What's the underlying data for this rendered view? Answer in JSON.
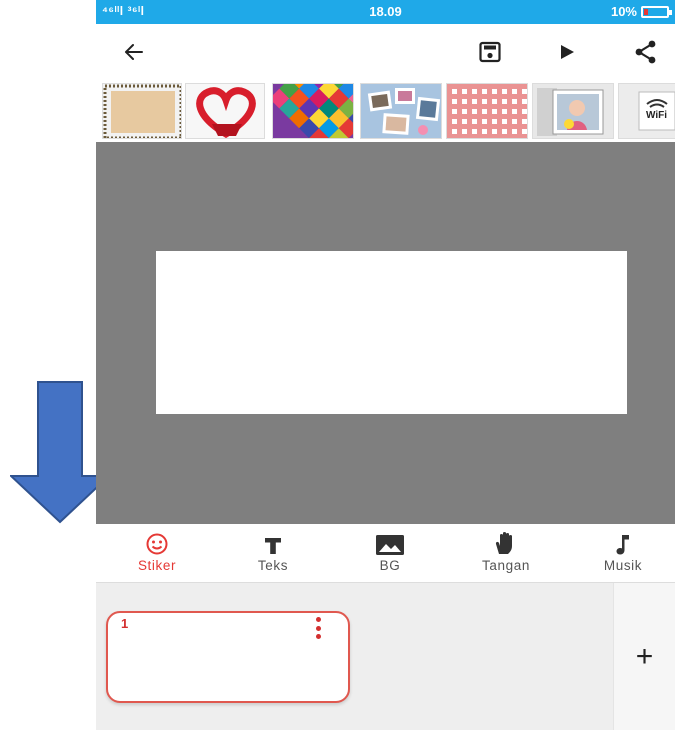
{
  "status_bar": {
    "signal": "⁴⁶ᴵᴵl ³⁶ᴵl",
    "time": "18.09",
    "battery": "10%",
    "battery_color": "#e53935",
    "bar_color": "#1fa9e8"
  },
  "toolbar": {
    "back_icon": "arrow-left-icon",
    "save_icon": "floppy-disk-icon",
    "play_icon": "play-icon",
    "share_icon": "share-icon"
  },
  "thumbnails": [
    {
      "name": "frame-thumbnail",
      "color": "#e7c9a0"
    },
    {
      "name": "heart-thumbnail",
      "color": "#d81e2c"
    },
    {
      "name": "mosaic-thumbnail",
      "color": "#7a3aa0"
    },
    {
      "name": "collage-thumbnail",
      "color": "#a8c4e0"
    },
    {
      "name": "gingham-thumbnail",
      "color": "#d93c3c"
    },
    {
      "name": "photo-thumbnail",
      "color": "#cfcfcf"
    },
    {
      "name": "wifi-thumbnail",
      "color": "#ececec"
    }
  ],
  "wifi_thumb_text": "WiFi",
  "tabs": [
    {
      "label": "Stiker",
      "icon": "smiley-icon",
      "active": true
    },
    {
      "label": "Teks",
      "icon": "text-icon",
      "active": false
    },
    {
      "label": "BG",
      "icon": "image-icon",
      "active": false
    },
    {
      "label": "Tangan",
      "icon": "hand-icon",
      "active": false
    },
    {
      "label": "Musik",
      "icon": "music-note-icon",
      "active": false
    }
  ],
  "timeline": {
    "slide_number": "1",
    "add_label": "+"
  },
  "colors": {
    "accent": "#e53935",
    "canvas_background": "#7f7f7f",
    "annotation_arrow": "#4472c4"
  }
}
